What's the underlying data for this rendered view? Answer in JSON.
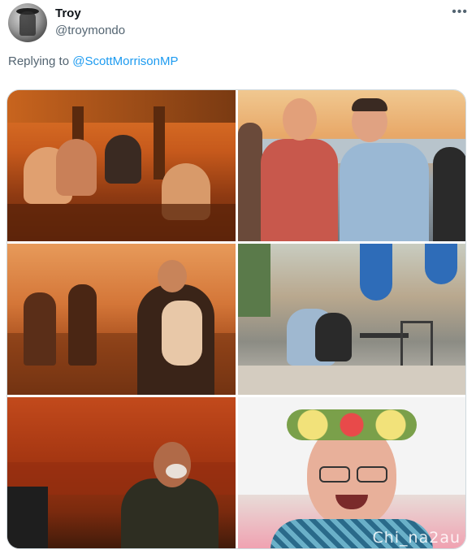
{
  "tweet": {
    "author_name": "Troy",
    "author_handle": "@troymondo",
    "more_icon": "more-horizontal-icon",
    "reply_prefix": "Replying to",
    "reply_to": "@ScottMorrisonMP"
  },
  "media": {
    "watermark": "Chi_na2au"
  },
  "colors": {
    "link": "#1d9bf0",
    "secondary_text": "#536471"
  }
}
